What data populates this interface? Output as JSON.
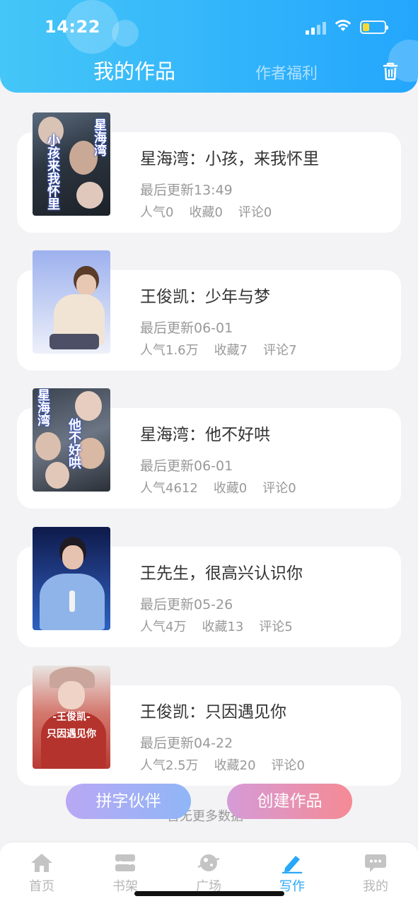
{
  "status_bar": {
    "time": "14:22"
  },
  "header": {
    "tabs": [
      {
        "label": "我的作品",
        "active": true
      },
      {
        "label": "作者福利",
        "active": false
      }
    ],
    "trash_icon": "trash-icon",
    "gradient": [
      "#45c6f7",
      "#24a6fd"
    ]
  },
  "works": [
    {
      "title": "星海湾：小孩，来我怀里",
      "updated": "最后更新13:49",
      "popularity": "人气0",
      "favorites": "收藏0",
      "comments": "评论0",
      "cover_text_a": "星海湾",
      "cover_text_b": "小孩来我怀里"
    },
    {
      "title": "王俊凯：少年与梦",
      "updated": "最后更新06-01",
      "popularity": "人气1.6万",
      "favorites": "收藏7",
      "comments": "评论7"
    },
    {
      "title": "星海湾：他不好哄",
      "updated": "最后更新06-01",
      "popularity": "人气4612",
      "favorites": "收藏0",
      "comments": "评论0",
      "cover_text_a": "星海湾",
      "cover_text_b": "他不好哄"
    },
    {
      "title": "王先生，很高兴认识你",
      "updated": "最后更新05-26",
      "popularity": "人气4万",
      "favorites": "收藏13",
      "comments": "评论5"
    },
    {
      "title": "王俊凯：只因遇见你",
      "updated": "最后更新04-22",
      "popularity": "人气2.5万",
      "favorites": "收藏20",
      "comments": "评论0",
      "cover_text_a": "-王俊凯-",
      "cover_text_b": "只因遇见你"
    }
  ],
  "load_more": "暂无更多数据",
  "buttons": {
    "partner": "拼字伙伴",
    "create": "创建作品"
  },
  "tabbar": [
    {
      "label": "首页",
      "icon": "home-icon"
    },
    {
      "label": "书架",
      "icon": "bookshelf-icon"
    },
    {
      "label": "广场",
      "icon": "planet-icon"
    },
    {
      "label": "写作",
      "icon": "pen-icon",
      "active": true
    },
    {
      "label": "我的",
      "icon": "chat-bubble-icon"
    }
  ],
  "colors": {
    "accent": "#29a8f8",
    "text": "#333333",
    "muted": "#999999"
  }
}
